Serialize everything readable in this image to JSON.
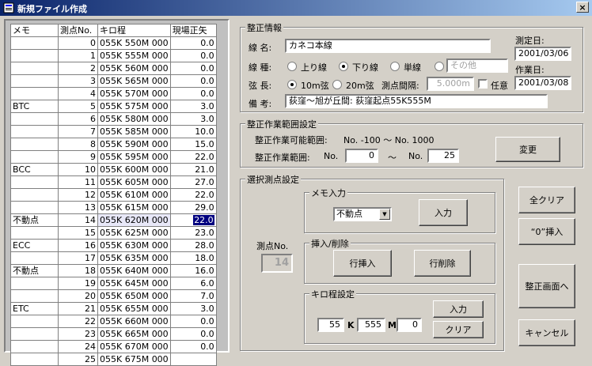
{
  "window": {
    "title": "新規ファイル作成",
    "close": "×"
  },
  "table": {
    "headers": [
      "メモ",
      "測点No.",
      "キロ程",
      "現場正矢"
    ],
    "rows": [
      {
        "memo": "",
        "no": "0",
        "km": "055K 550M 000",
        "val": "0.0"
      },
      {
        "memo": "",
        "no": "1",
        "km": "055K 555M 000",
        "val": "0.0"
      },
      {
        "memo": "",
        "no": "2",
        "km": "055K 560M 000",
        "val": "0.0"
      },
      {
        "memo": "",
        "no": "3",
        "km": "055K 565M 000",
        "val": "0.0"
      },
      {
        "memo": "",
        "no": "4",
        "km": "055K 570M 000",
        "val": "0.0"
      },
      {
        "memo": "BTC",
        "no": "5",
        "km": "055K 575M 000",
        "val": "3.0"
      },
      {
        "memo": "",
        "no": "6",
        "km": "055K 580M 000",
        "val": "3.0"
      },
      {
        "memo": "",
        "no": "7",
        "km": "055K 585M 000",
        "val": "10.0"
      },
      {
        "memo": "",
        "no": "8",
        "km": "055K 590M 000",
        "val": "15.0"
      },
      {
        "memo": "",
        "no": "9",
        "km": "055K 595M 000",
        "val": "22.0"
      },
      {
        "memo": "BCC",
        "no": "10",
        "km": "055K 600M 000",
        "val": "21.0"
      },
      {
        "memo": "",
        "no": "11",
        "km": "055K 605M 000",
        "val": "27.0"
      },
      {
        "memo": "",
        "no": "12",
        "km": "055K 610M 000",
        "val": "22.0"
      },
      {
        "memo": "",
        "no": "13",
        "km": "055K 615M 000",
        "val": "29.0"
      },
      {
        "memo": "不動点",
        "no": "14",
        "km": "055K 620M 000",
        "val": "22.0"
      },
      {
        "memo": "",
        "no": "15",
        "km": "055K 625M 000",
        "val": "23.0"
      },
      {
        "memo": "ECC",
        "no": "16",
        "km": "055K 630M 000",
        "val": "28.0"
      },
      {
        "memo": "",
        "no": "17",
        "km": "055K 635M 000",
        "val": "18.0"
      },
      {
        "memo": "不動点",
        "no": "18",
        "km": "055K 640M 000",
        "val": "16.0"
      },
      {
        "memo": "",
        "no": "19",
        "km": "055K 645M 000",
        "val": "6.0"
      },
      {
        "memo": "",
        "no": "20",
        "km": "055K 650M 000",
        "val": "7.0"
      },
      {
        "memo": "ETC",
        "no": "21",
        "km": "055K 655M 000",
        "val": "3.0"
      },
      {
        "memo": "",
        "no": "22",
        "km": "055K 660M 000",
        "val": "0.0"
      },
      {
        "memo": "",
        "no": "23",
        "km": "055K 665M 000",
        "val": "0.0"
      },
      {
        "memo": "",
        "no": "24",
        "km": "055K 670M 000",
        "val": "0.0"
      },
      {
        "memo": "",
        "no": "25",
        "km": "055K 675M 000",
        "val": ""
      }
    ],
    "selected_index": 14
  },
  "info": {
    "title": "整正情報",
    "line_name_label": "線  名:",
    "line_name": "カネコ本線",
    "line_type_label": "線  種:",
    "line_up": "上り線",
    "line_down": "下り線",
    "line_single": "単線",
    "line_other": "その他",
    "chord_label": "弦  長:",
    "chord_10": "10m弦",
    "chord_20": "20m弦",
    "interval_label": "測点間隔:",
    "interval_value": "5.000m",
    "optional_label": "任意",
    "remark_label": "備  考:",
    "remark": "荻窪～旭が丘間:  荻窪起点55K555M",
    "measure_date_label": "測定日:",
    "measure_date": "2001/03/06",
    "work_date_label": "作業日:",
    "work_date": "2001/03/08"
  },
  "range": {
    "title": "整正作業範囲設定",
    "possible_label": "整正作業可能範囲:",
    "possible_value": "No. -100 ～ No. 1000",
    "range_label": "整正作業範囲:",
    "no1": "No.",
    "from": "0",
    "tilde": "～",
    "no2": "No.",
    "to": "25",
    "change_button": "変更"
  },
  "selected": {
    "title": "選択測点設定",
    "point_label": "測点No.",
    "point_value": "14",
    "memo_title": "メモ入力",
    "memo_value": "不動点",
    "memo_input_button": "入力",
    "insdel_title": "挿入/削除",
    "insert_button": "行挿入",
    "delete_button": "行削除",
    "km_title": "キロ程設定",
    "km_k": "55",
    "k_mark": "K",
    "km_m": "555",
    "m_mark": "M",
    "km_mm": "0",
    "km_input_button": "入力",
    "km_clear_button": "クリア"
  },
  "side": {
    "all_clear": "全クリア",
    "insert_zero": "“0”挿入",
    "to_screen": "整正画面へ",
    "cancel": "キャンセル"
  }
}
